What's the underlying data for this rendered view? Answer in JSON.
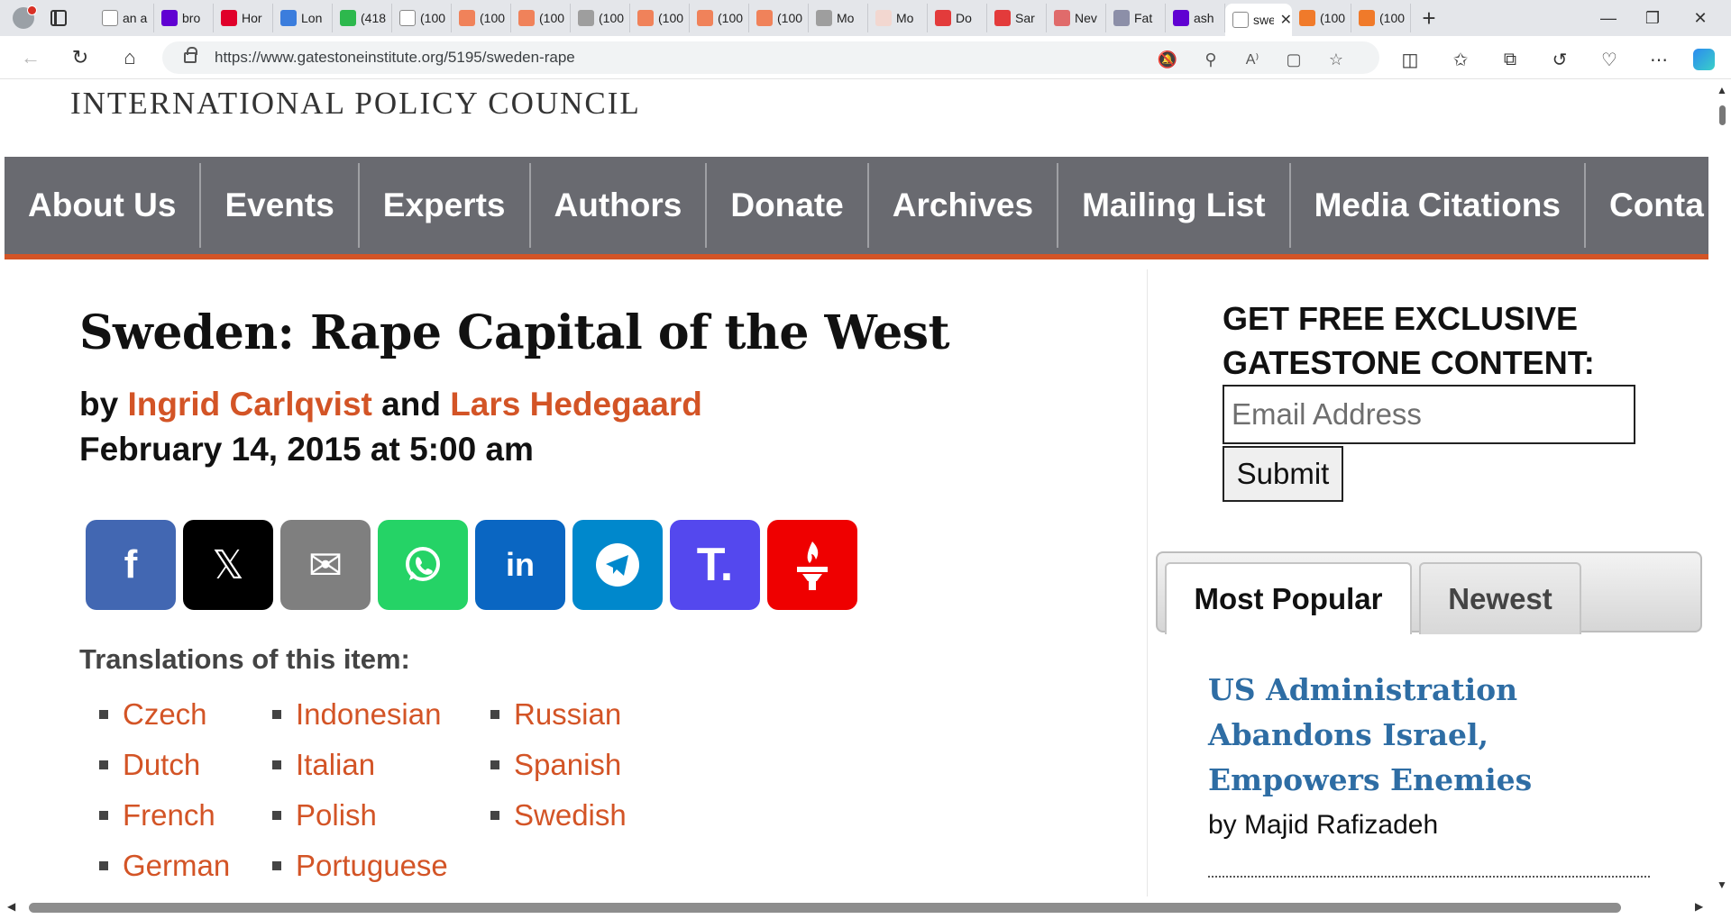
{
  "browser": {
    "tabs": [
      {
        "title": "an a",
        "icon": "page-icon",
        "color": "#ffffff"
      },
      {
        "title": "bro",
        "icon": "yahoo-icon",
        "color": "#6001d2"
      },
      {
        "title": "Hor",
        "icon": "shield-icon",
        "color": "#e0002a"
      },
      {
        "title": "Lon",
        "icon": "five-icon",
        "color": "#3b7ddd"
      },
      {
        "title": "(418",
        "icon": "g-icon",
        "color": "#2db84d"
      },
      {
        "title": "(100",
        "icon": "page-icon",
        "color": "#ffffff"
      },
      {
        "title": "(100",
        "icon": "bookmark-icon",
        "color": "#f0825a"
      },
      {
        "title": "(100",
        "icon": "bookmark-icon",
        "color": "#f0825a"
      },
      {
        "title": "(100",
        "icon": "globe-icon",
        "color": "#9e9e9e"
      },
      {
        "title": "(100",
        "icon": "bookmark-icon",
        "color": "#f0825a"
      },
      {
        "title": "(100",
        "icon": "bookmark-icon",
        "color": "#f0825a"
      },
      {
        "title": "(100",
        "icon": "bookmark-icon",
        "color": "#f0825a"
      },
      {
        "title": "Mo",
        "icon": "wordpress-icon",
        "color": "#9e9e9e"
      },
      {
        "title": "Mo",
        "icon": "bi-icon",
        "color": "#f2d7d0"
      },
      {
        "title": "Do",
        "icon": "youtube-icon",
        "color": "#e33b3b"
      },
      {
        "title": "Sar",
        "icon": "youtube-icon",
        "color": "#e33b3b"
      },
      {
        "title": "Nev",
        "icon": "r-icon",
        "color": "#e06b6b"
      },
      {
        "title": "Fat",
        "icon": "arrow-icon",
        "color": "#8c8fa8"
      },
      {
        "title": "ash",
        "icon": "yahoo-icon",
        "color": "#6001d2"
      },
      {
        "title": "swe",
        "icon": "gatestone-icon",
        "color": "#ffffff",
        "active": true
      },
      {
        "title": "(100",
        "icon": "bookmark-icon",
        "color": "#f07a2a"
      },
      {
        "title": "(100",
        "icon": "bookmark-icon",
        "color": "#f07a2a"
      }
    ],
    "url": "https://www.gatestoneinstitute.org/5195/sweden-rape"
  },
  "site": {
    "title": "INTERNATIONAL POLICY COUNCIL",
    "nav": [
      "About Us",
      "Events",
      "Experts",
      "Authors",
      "Donate",
      "Archives",
      "Mailing List",
      "Media Citations",
      "Conta"
    ]
  },
  "article": {
    "title": "Sweden: Rape Capital of the West",
    "by": "by ",
    "author1": "Ingrid Carlqvist",
    "and": " and ",
    "author2": "Lars Hedegaard",
    "date": "February 14, 2015 at 5:00 am",
    "share_buttons": [
      {
        "name": "facebook",
        "label": "f",
        "color": "#4267b2"
      },
      {
        "name": "x",
        "label": "𝕏",
        "color": "#000000"
      },
      {
        "name": "email",
        "label": "✉",
        "color": "#7f7f7f"
      },
      {
        "name": "whatsapp",
        "label": "",
        "color": "#25d366"
      },
      {
        "name": "linkedin",
        "label": "in",
        "color": "#0a66c2"
      },
      {
        "name": "telegram",
        "label": "",
        "color": "#0088cc"
      },
      {
        "name": "truth-social",
        "label": "T.",
        "color": "#5448ee"
      },
      {
        "name": "gettr",
        "label": "",
        "color": "#ef0000"
      }
    ],
    "translations_label": "Translations of this item:",
    "translations": [
      [
        "Czech",
        "Dutch",
        "French",
        "German"
      ],
      [
        "Indonesian",
        "Italian",
        "Polish",
        "Portuguese"
      ],
      [
        "Russian",
        "Spanish",
        "Swedish"
      ]
    ]
  },
  "sidebar": {
    "heading_line1": "GET FREE EXCLUSIVE",
    "heading_line2": "GATESTONE CONTENT:",
    "email_placeholder": "Email Address",
    "submit_label": "Submit",
    "tabs": [
      "Most Popular",
      "Newest"
    ],
    "popular": {
      "title": "US Administration Abandons Israel, Empowers Enemies",
      "author": "by Majid Rafizadeh"
    }
  },
  "colors": {
    "accent": "#d35426",
    "nav_bg": "#696a70",
    "link_blue": "#2e6da4"
  }
}
